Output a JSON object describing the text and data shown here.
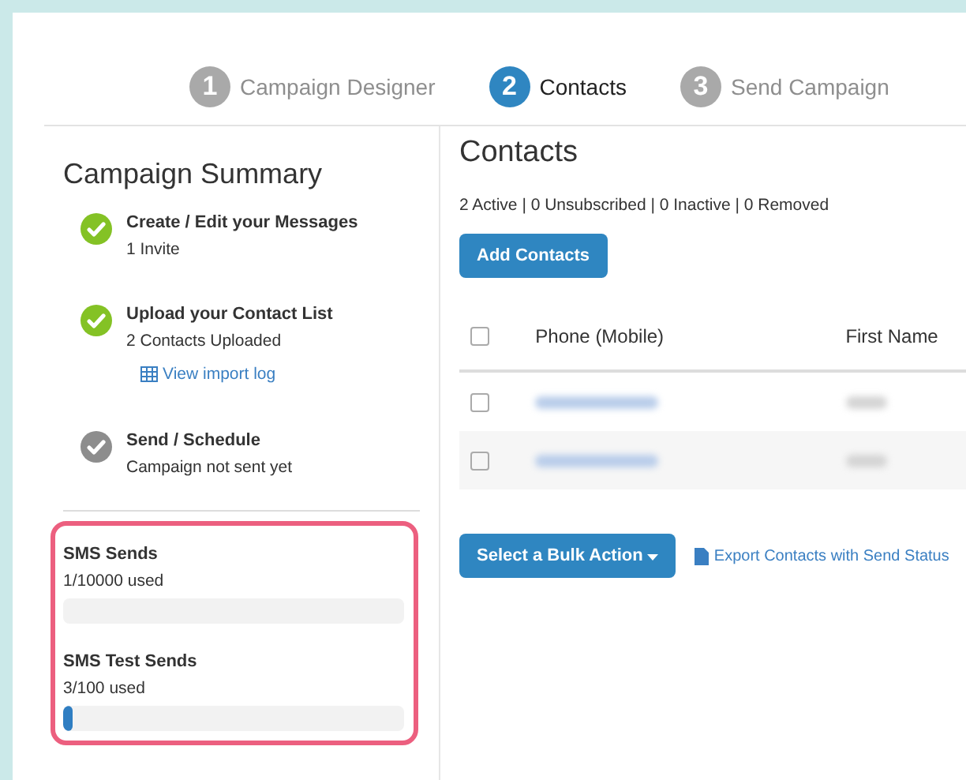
{
  "steps": [
    {
      "number": "1",
      "label": "Campaign Designer",
      "selected": false
    },
    {
      "number": "2",
      "label": "Contacts",
      "selected": true
    },
    {
      "number": "3",
      "label": "Send Campaign",
      "selected": false
    }
  ],
  "summary": {
    "title": "Campaign Summary",
    "items": [
      {
        "title": "Create / Edit your Messages",
        "detail": "1 Invite",
        "done": true
      },
      {
        "title": "Upload your Contact List",
        "detail": "2 Contacts Uploaded",
        "link": "View import log",
        "done": true
      },
      {
        "title": "Send / Schedule",
        "detail": "Campaign not sent yet",
        "done": false
      }
    ],
    "usage": [
      {
        "label": "SMS Sends",
        "reading": "1/10000 used",
        "level": 0.0001
      },
      {
        "label": "SMS Test Sends",
        "reading": "3/100 used",
        "level": 0.03
      }
    ]
  },
  "contacts": {
    "title": "Contacts",
    "stats": "2 Active | 0 Unsubscribed | 0 Inactive | 0 Removed",
    "add_button": "Add Contacts",
    "table": {
      "columns": [
        "Phone (Mobile)",
        "First Name"
      ],
      "header_checked": false,
      "rows": [
        {
          "checked": false
        },
        {
          "checked": false
        }
      ]
    },
    "bulk_button": "Select a Bulk Action",
    "export_link": "Export Contacts with Send Status"
  }
}
